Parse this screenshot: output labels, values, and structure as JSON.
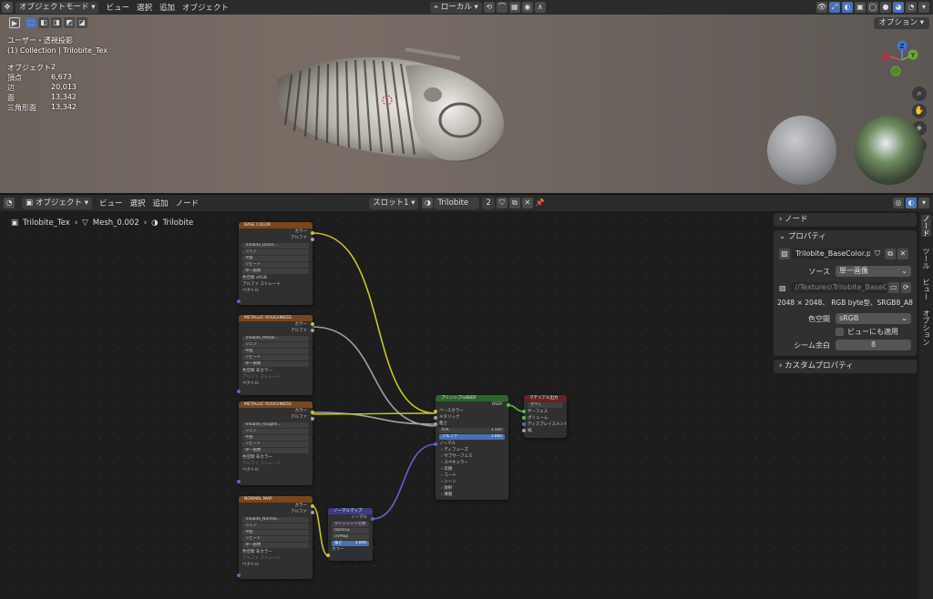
{
  "viewport": {
    "header": {
      "mode": "オブジェクトモード",
      "menus": [
        "ビュー",
        "選択",
        "追加",
        "オブジェクト"
      ],
      "transform_orientation": "ローカル",
      "options_label": "オプション"
    },
    "view_name": "ユーザー・透視投影",
    "collection": "(1) Collection | Trilobite_Tex",
    "stats": [
      {
        "label": "オブジェクト",
        "value": "2"
      },
      {
        "label": "頂点",
        "value": "6,673"
      },
      {
        "label": "辺",
        "value": "20,013"
      },
      {
        "label": "面",
        "value": "13,342"
      },
      {
        "label": "三角形面",
        "value": "13,342"
      }
    ],
    "gizmo_labels": {
      "z": "Z",
      "y": "Y"
    }
  },
  "node_editor": {
    "header": {
      "object_dropdown": "オブジェクト",
      "menus": [
        "ビュー",
        "選択",
        "追加",
        "ノード"
      ],
      "slot": "スロット1",
      "material": "Trilobite",
      "users": "2"
    },
    "breadcrumb": [
      "Trilobite_Tex",
      "Mesh_0.002",
      "Trilobite"
    ],
    "nodes": {
      "base_color": {
        "title": "BASE COLOR",
        "out_color": "カラー",
        "out_alpha": "アルファ",
        "image": "Trilobite_BaseC...",
        "interp": "リニア",
        "proj": "平面",
        "ext": "リピート",
        "src": "単一画像",
        "cs_label": "色空間",
        "cs": "sRGB",
        "alpha_label": "アルファ",
        "alpha": "ストレート",
        "vector": "ベクトル"
      },
      "metallic": {
        "title": "METALLIC ROUGHNESS",
        "out_color": "カラー",
        "out_alpha": "アルファ",
        "image": "Trilobite_Metall...",
        "interp": "リニア",
        "proj": "平面",
        "ext": "リピート",
        "src": "単一画像",
        "cs_label": "色空間",
        "cs": "非カラー",
        "alpha_label": "アルファ",
        "alpha": "ストレート",
        "vector": "ベクトル"
      },
      "metallic2": {
        "title": "METALLIC ROUGHNESS",
        "out_color": "カラー",
        "out_alpha": "アルファ",
        "image": "Trilobite_Roughn...",
        "interp": "リニア",
        "proj": "平面",
        "ext": "リピート",
        "src": "単一画像",
        "cs_label": "色空間",
        "cs": "非カラー",
        "alpha_label": "アルファ",
        "alpha": "ストレート",
        "vector": "ベクトル"
      },
      "normal": {
        "title": "NORMAL MAP",
        "out_color": "カラー",
        "out_alpha": "アルファ",
        "image": "Trilobite_Normal...",
        "interp": "リニア",
        "proj": "平面",
        "ext": "リピート",
        "src": "単一画像",
        "cs_label": "色空間",
        "cs": "非カラー",
        "alpha_label": "アルファ",
        "alpha": "ストレート",
        "vector": "ベクトル"
      },
      "normalmap": {
        "title": "ノーマルマップ",
        "out": "ノーマル",
        "space": "タンジェント空間",
        "renderer": "OpenGL",
        "uv": "UVMap",
        "strength_label": "強さ",
        "strength": "1.000",
        "color": "カラー"
      },
      "bsdf": {
        "title": "プリンシプルBSDF",
        "out": "BSDF",
        "inputs": [
          "ベースカラー",
          "メタリック",
          "粗さ"
        ],
        "ior_label": "IOR",
        "ior": "1.500",
        "alpha_label": "アルファ",
        "alpha": "1.000",
        "normal": "ノーマル",
        "groups": [
          "ディフューズ",
          "サブサーフェス",
          "スペキュラー",
          "伝播",
          "コート",
          "シーン",
          "放射",
          "薄膜"
        ]
      },
      "output": {
        "title": "マテリアル出力",
        "target": "すべて",
        "inputs": [
          "サーフェス",
          "ボリューム",
          "ディスプレイスメント",
          "幅"
        ]
      }
    },
    "panel": {
      "node_section": "ノード",
      "properties_section": "プロパティ",
      "image_name": "Trilobite_BaseColor.p...",
      "source_label": "ソース",
      "source": "単一画像",
      "filepath": "//Textures\\Trilobite_BaseC...",
      "info": "2048 × 2048、 RGB byte型、SRGB8_A8",
      "colorspace_label": "色空間",
      "colorspace": "sRGB",
      "view_transform_label": "ビューにも適用",
      "seam_label": "シーム余白",
      "seam": "8",
      "custom_props": "カスタムプロパティ"
    },
    "tabs": [
      "ノード",
      "ツール",
      "ビュー",
      "オプション"
    ]
  }
}
